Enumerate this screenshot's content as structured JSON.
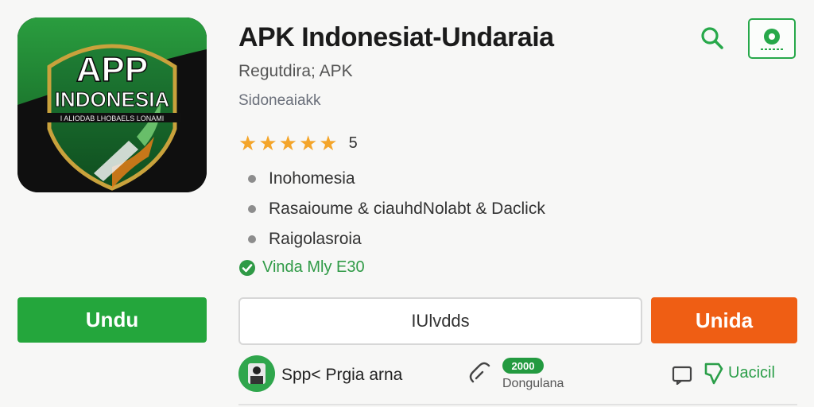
{
  "app": {
    "title": "APK Indonesiat-Undaraia",
    "subtitle": "Regutdira; APK",
    "developer": "Sidoneaiakk",
    "icon": {
      "name": "app-logo",
      "line1": "APP",
      "line2": "INDONESIA",
      "line3": "I ALIODAB LHOBAELS LONAMI"
    }
  },
  "toolbar": {
    "search_icon": "search-icon",
    "badge_icon": "shield-badge-icon",
    "accent_color": "#27a84a"
  },
  "rating": {
    "stars": 5,
    "max": 5,
    "value": "5",
    "star_color": "#f4a52a"
  },
  "features": [
    {
      "label": "Inohomesia"
    },
    {
      "label": "Rasaioume & ciauhdNolabt & Daclick"
    },
    {
      "label": "Raigolasroia"
    }
  ],
  "verified": {
    "icon": "check-circle-icon",
    "label": "Vinda Mly E30"
  },
  "buttons": {
    "primary_label": "Undu",
    "outline_label": "IUlvdds",
    "orange_label": "Unida",
    "primary_color": "#24a63c",
    "orange_color": "#ef5e14"
  },
  "footer": {
    "publisher": "Spp< Prgia arna",
    "count_badge": "2000",
    "count_label": "Dongulana",
    "report_label": "Uacicil"
  }
}
